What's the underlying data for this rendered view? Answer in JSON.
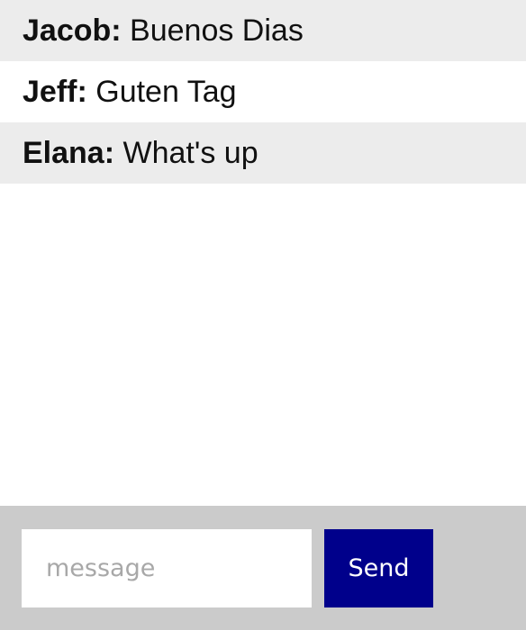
{
  "messages": [
    {
      "author": "Jacob:",
      "text": "Buenos Dias"
    },
    {
      "author": "Jeff:",
      "text": "Guten Tag"
    },
    {
      "author": "Elana:",
      "text": "What's up"
    }
  ],
  "composer": {
    "placeholder": "message",
    "value": "",
    "send_label": "Send"
  },
  "colors": {
    "send_button": "#00008b",
    "footer": "#cbcbcb",
    "alt_row": "#ececec"
  }
}
